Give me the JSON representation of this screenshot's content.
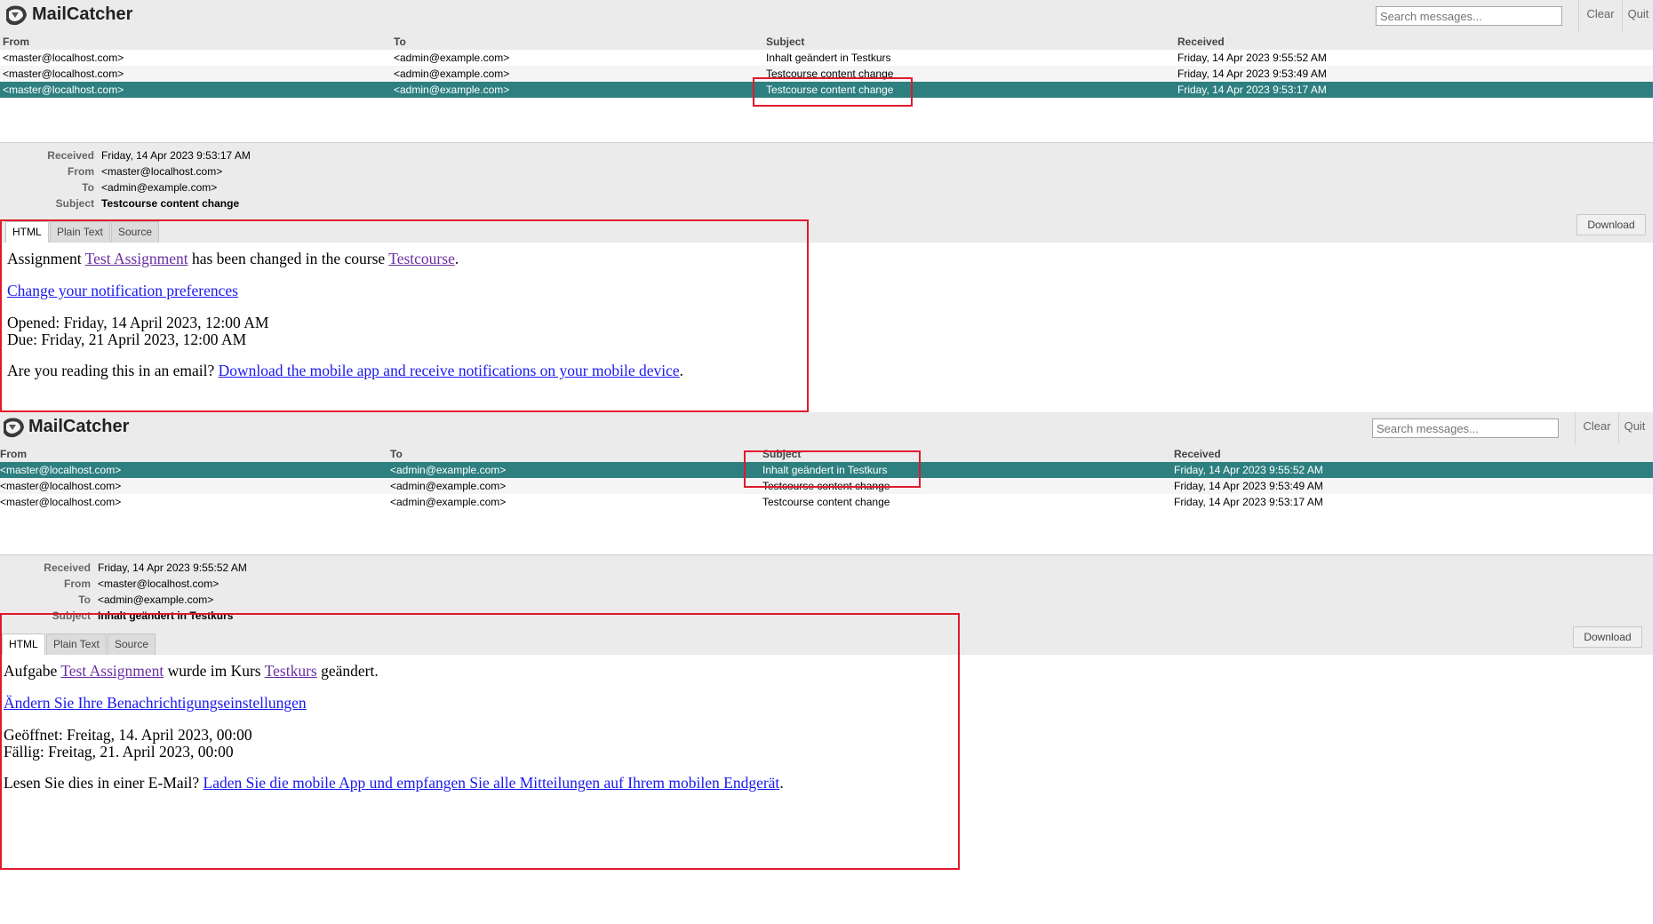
{
  "app": {
    "name": "MailCatcher",
    "search_placeholder": "Search messages...",
    "clear_label": "Clear",
    "quit_label": "Quit"
  },
  "columns": {
    "from": "From",
    "to": "To",
    "subject": "Subject",
    "received": "Received"
  },
  "messages": [
    {
      "from": "<master@localhost.com>",
      "to": "<admin@example.com>",
      "subject": "Inhalt geändert in Testkurs",
      "received": "Friday, 14 Apr 2023 9:55:52 AM"
    },
    {
      "from": "<master@localhost.com>",
      "to": "<admin@example.com>",
      "subject": "Testcourse content change",
      "received": "Friday, 14 Apr 2023 9:53:49 AM"
    },
    {
      "from": "<master@localhost.com>",
      "to": "<admin@example.com>",
      "subject": "Testcourse content change",
      "received": "Friday, 14 Apr 2023 9:53:17 AM"
    }
  ],
  "meta_labels": {
    "received": "Received",
    "from": "From",
    "to": "To",
    "subject": "Subject"
  },
  "tabs": {
    "html": "HTML",
    "plain": "Plain Text",
    "source": "Source"
  },
  "download_label": "Download",
  "views": [
    {
      "selected_index": 2,
      "meta": {
        "received": "Friday, 14 Apr 2023 9:53:17 AM",
        "from": "<master@localhost.com>",
        "to": "<admin@example.com>",
        "subject": "Testcourse content change"
      },
      "body": {
        "l1_pre": "Assignment ",
        "l1_link1": "Test Assignment",
        "l1_mid": " has been changed in the course ",
        "l1_link2": "Testcourse",
        "l1_post": ".",
        "l2_link": "Change your notification preferences",
        "l3": "Opened: Friday, 14 April 2023, 12:00 AM",
        "l4": "Due: Friday, 21 April 2023, 12:00 AM",
        "l5_pre": "Are you reading this in an email? ",
        "l5_link": "Download the mobile app and receive notifications on your mobile device",
        "l5_post": "."
      }
    },
    {
      "selected_index": 0,
      "meta": {
        "received": "Friday, 14 Apr 2023 9:55:52 AM",
        "from": "<master@localhost.com>",
        "to": "<admin@example.com>",
        "subject": "Inhalt geändert in Testkurs"
      },
      "body": {
        "l1_pre": "Aufgabe ",
        "l1_link1": "Test Assignment",
        "l1_mid": " wurde im Kurs ",
        "l1_link2": "Testkurs",
        "l1_post": " geändert.",
        "l2_link": "Ändern Sie Ihre Benachrichtigungseinstellungen",
        "l3": "Geöffnet: Freitag, 14. April 2023, 00:00",
        "l4": "Fällig: Freitag, 21. April 2023, 00:00",
        "l5_pre": "Lesen Sie dies in einer E-Mail? ",
        "l5_link": "Laden Sie die mobile App und empfangen Sie alle Mitteilungen auf Ihrem mobilen Endgerät",
        "l5_post": "."
      }
    }
  ],
  "colors": {
    "selected_row": "#2e7f80",
    "annotation": "#e01a2c",
    "visited_link": "#6b2fa0",
    "link": "#1a1aee"
  }
}
